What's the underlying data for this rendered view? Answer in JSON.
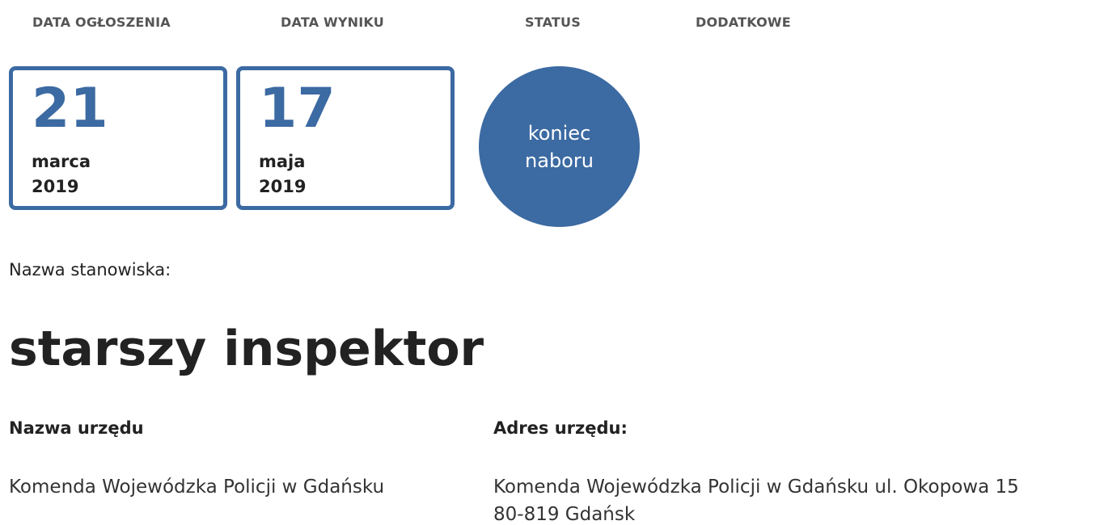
{
  "columns": {
    "announcement_date": "DATA OGŁOSZENIA",
    "result_date": "DATA WYNIKU",
    "status": "STATUS",
    "additional": "DODATKOWE"
  },
  "announcement": {
    "day": "21",
    "month": "marca",
    "year": "2019"
  },
  "result": {
    "day": "17",
    "month": "maja",
    "year": "2019"
  },
  "status": {
    "line1": "koniec",
    "line2": "naboru",
    "color": "#3c6aa2"
  },
  "position": {
    "label": "Nazwa stanowiska:",
    "title": "starszy inspektor"
  },
  "office": {
    "name_label": "Nazwa urzędu",
    "name": "Komenda Wojewódzka Policji w Gdańsku",
    "address_label": "Adres urzędu:",
    "address_line1": "Komenda Wojewódzka Policji w Gdańsku ul. Okopowa 15",
    "address_line2": "80-819 Gdańsk"
  },
  "colors": {
    "accent": "#3c6aa2",
    "header_text": "#555555"
  }
}
